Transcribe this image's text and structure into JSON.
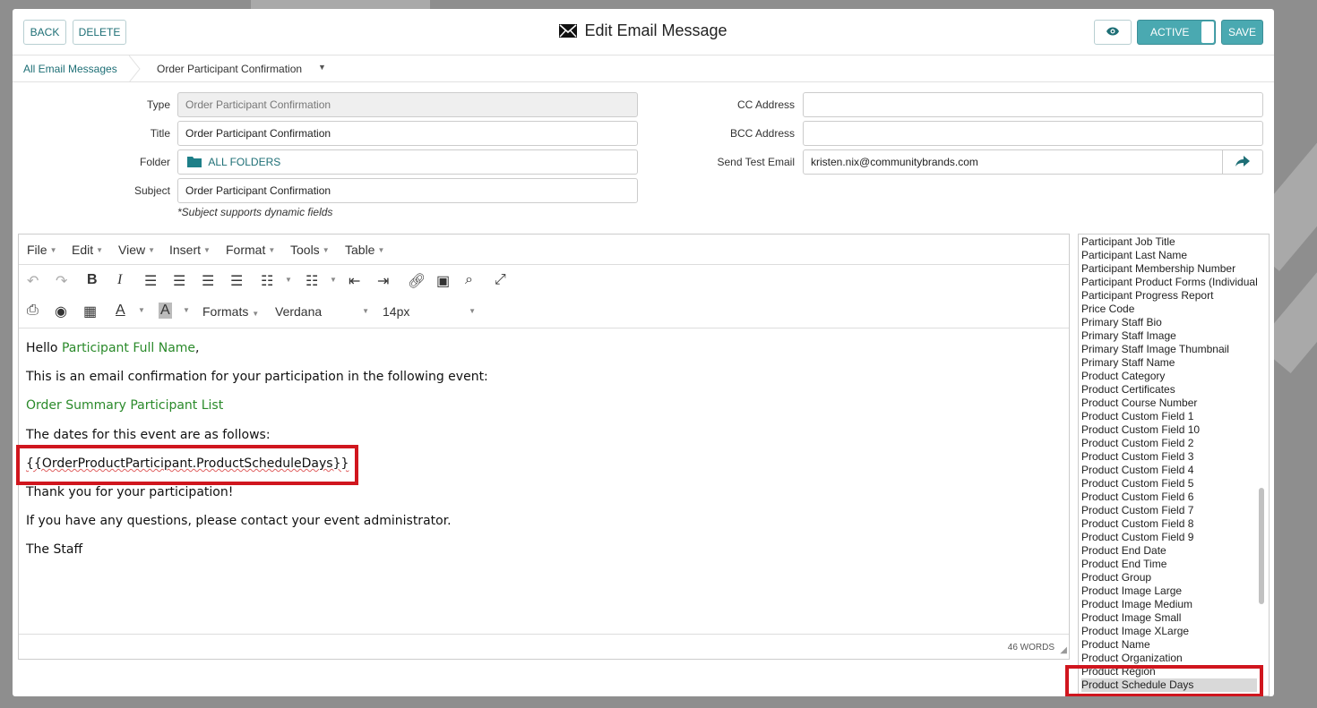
{
  "header": {
    "back_label": "BACK",
    "delete_label": "DELETE",
    "title": "Edit Email Message",
    "active_label": "ACTIVE",
    "save_label": "SAVE"
  },
  "breadcrumb": {
    "parent": "All Email Messages",
    "current": "Order Participant Confirmation"
  },
  "form": {
    "type_label": "Type",
    "type_value": "Order Participant Confirmation",
    "title_label": "Title",
    "title_value": "Order Participant Confirmation",
    "folder_label": "Folder",
    "folder_value": "ALL FOLDERS",
    "subject_label": "Subject",
    "subject_value": "Order Participant Confirmation",
    "subject_hint": "*Subject supports dynamic fields",
    "cc_label": "CC Address",
    "cc_value": "",
    "bcc_label": "BCC Address",
    "bcc_value": "",
    "test_label": "Send Test Email",
    "test_value": "kristen.nix@communitybrands.com"
  },
  "editor": {
    "menus": [
      "File",
      "Edit",
      "View",
      "Insert",
      "Format",
      "Tools",
      "Table"
    ],
    "formats_label": "Formats",
    "font_family": "Verdana",
    "font_size": "14px",
    "body": {
      "hello": "Hello ",
      "participant_name": "Participant Full Name",
      "comma": ",",
      "line2": "This is an email confirmation for your participation in the following event:",
      "line3": "Order Summary Participant List",
      "line4": "The dates for this event are as follows:",
      "line5": "{{OrderProductParticipant.ProductScheduleDays}}",
      "line6": "Thank you for your participation!",
      "line7": "If you have any questions, please contact your event administrator.",
      "line8": "The Staff"
    },
    "word_count": "46 WORDS"
  },
  "fields": [
    "Participant Job Title",
    "Participant Last Name",
    "Participant Membership Number",
    "Participant Product Forms (Individual)",
    "Participant Progress Report",
    "Price Code",
    "Primary Staff Bio",
    "Primary Staff Image",
    "Primary Staff Image Thumbnail",
    "Primary Staff Name",
    "Product Category",
    "Product Certificates",
    "Product Course Number",
    "Product Custom Field 1",
    "Product Custom Field 10",
    "Product Custom Field 2",
    "Product Custom Field 3",
    "Product Custom Field 4",
    "Product Custom Field 5",
    "Product Custom Field 6",
    "Product Custom Field 7",
    "Product Custom Field 8",
    "Product Custom Field 9",
    "Product End Date",
    "Product End Time",
    "Product Group",
    "Product Image Large",
    "Product Image Medium",
    "Product Image Small",
    "Product Image XLarge",
    "Product Name",
    "Product Organization",
    "Product Region",
    "Product Schedule Days"
  ],
  "selected_field": "Product Schedule Days",
  "colors": {
    "accent": "#4aa9b1",
    "link": "#1e6f76",
    "dynamic_field": "#2a8a2a",
    "highlight": "#d0161e"
  }
}
